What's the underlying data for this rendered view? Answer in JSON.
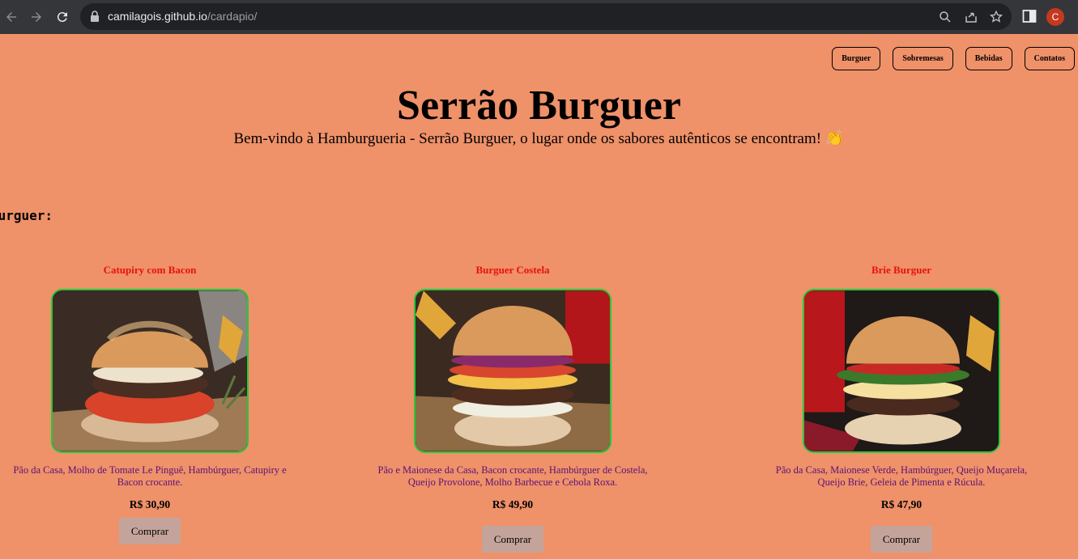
{
  "browser": {
    "url_host": "camilagois.github.io",
    "url_path": "/cardapio/",
    "profile_initial": "C"
  },
  "nav": [
    "Burguer",
    "Sobremesas",
    "Bebidas",
    "Contatos"
  ],
  "header": {
    "title": "Serrão Burguer",
    "welcome": "Bem-vindo à Hamburgueria - Serrão Burguer, o lugar onde os sabores autênticos se encontram! 👏"
  },
  "section_label": "Burguer:",
  "products": [
    {
      "name": "Catupiry com Bacon",
      "description": "Pão da Casa, Molho de Tomate Le Pinguê, Hambúrguer, Catupiry e Bacon crocante.",
      "price": "R$ 30,90",
      "button": "Comprar"
    },
    {
      "name": "Burguer Costela",
      "description": "Pão e Maionese da Casa, Bacon crocante, Hambúrguer de Costela, Queijo Provolone, Molho Barbecue e Cebola Roxa.",
      "price": "R$ 49,90",
      "button": "Comprar"
    },
    {
      "name": "Brie Burguer",
      "description": "Pão da Casa, Maionese Verde, Hambúrguer, Queijo Muçarela, Queijo Brie, Geleia de Pimenta e Rúcula.",
      "price": "R$ 47,90",
      "button": "Comprar"
    }
  ]
}
